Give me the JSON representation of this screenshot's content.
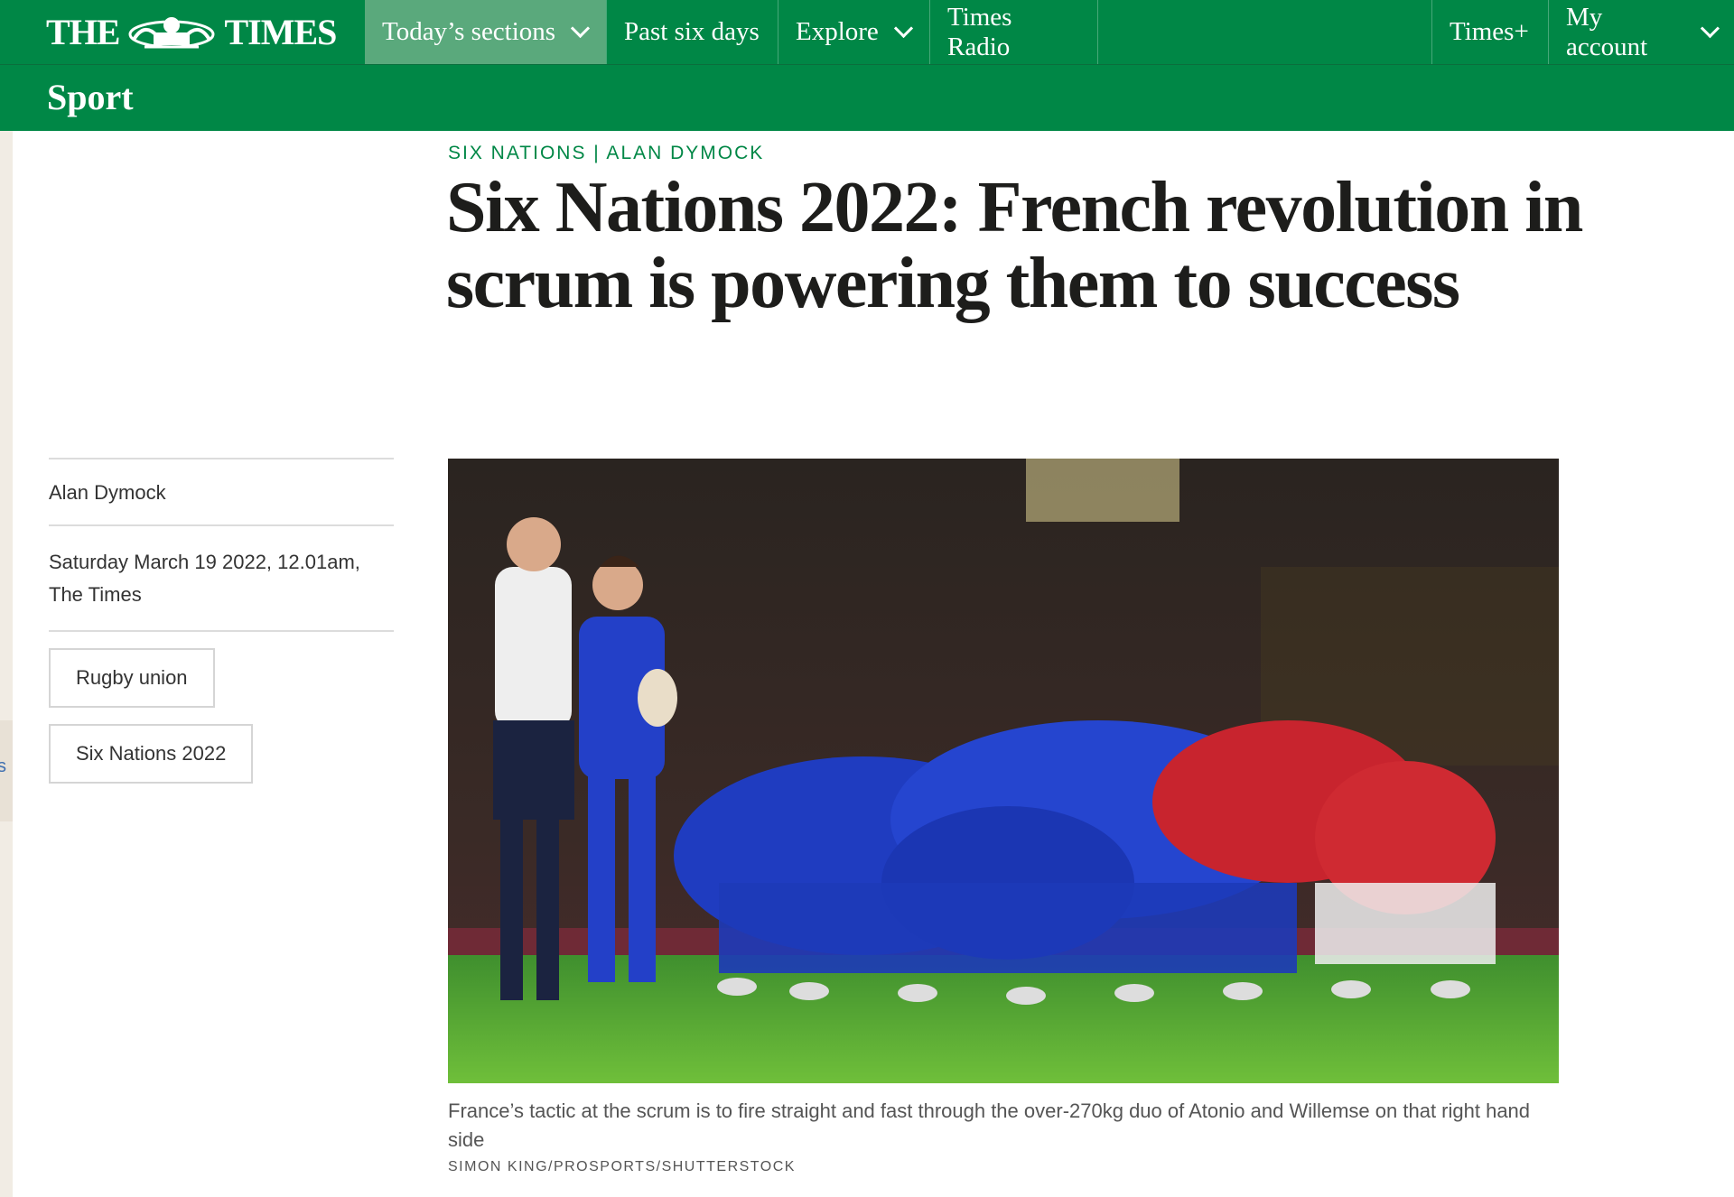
{
  "nav": {
    "logo_left": "THE",
    "logo_right": "TIMES",
    "items": [
      "Today’s sections",
      "Past six days",
      "Explore",
      "Times Radio"
    ],
    "times_plus": "Times+",
    "my_account": "My account"
  },
  "section": {
    "title": "Sport"
  },
  "article": {
    "kicker": "SIX NATIONS | ALAN DYMOCK",
    "headline": "Six Nations 2022: French revolution in scrum is powering them to success",
    "author": "Alan Dymock",
    "date": "Saturday March 19 2022, 12.01am, The Times",
    "tags": [
      "Rugby union",
      "Six Nations 2022"
    ],
    "caption": "France’s tactic at the scrum is to fire straight and fast through the over-270kg duo of Atonio and Willemse on that right hand side",
    "credit": "SIMON KING/PROSPORTS/SHUTTERSTOCK"
  },
  "edge_glyph": "s",
  "colors": {
    "brand_green": "#008746",
    "active_tab": "#5aa97c",
    "kicker_green": "#008746"
  }
}
